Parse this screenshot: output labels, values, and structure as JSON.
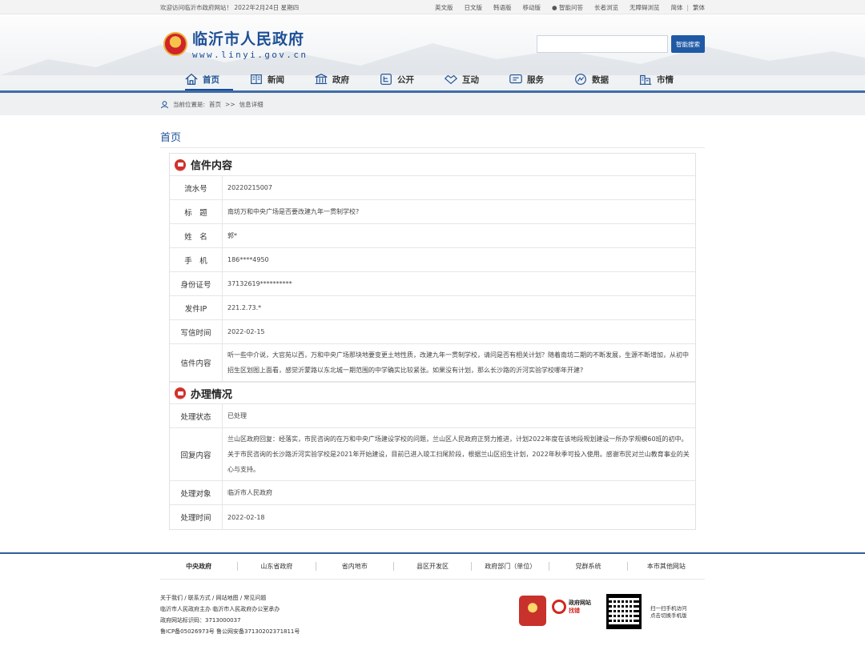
{
  "topbar": {
    "welcome": "欢迎访问临沂市政府网站！ 2022年2月24日 星期四",
    "links": [
      "英文版",
      "日文版",
      "韩语版",
      "移动版",
      "智能问答",
      "长者浏览",
      "无障碍浏览",
      "简体",
      "繁体"
    ]
  },
  "header": {
    "site_name": "临沂市人民政府",
    "site_url": "www.linyi.gov.cn",
    "search_button": "智能搜索",
    "search_placeholder": ""
  },
  "nav": [
    {
      "label": "首页",
      "icon": "home-icon"
    },
    {
      "label": "新闻",
      "icon": "newspaper-icon"
    },
    {
      "label": "政府",
      "icon": "building-icon"
    },
    {
      "label": "公开",
      "icon": "open-icon"
    },
    {
      "label": "互动",
      "icon": "handshake-icon"
    },
    {
      "label": "服务",
      "icon": "service-icon"
    },
    {
      "label": "数据",
      "icon": "data-icon"
    },
    {
      "label": "市情",
      "icon": "city-icon"
    }
  ],
  "breadcrumb": {
    "prefix": "当前位置是:",
    "home": "首页",
    "sep": ">>",
    "current": "信息详细"
  },
  "page_title": "首页",
  "letter": {
    "section_title": "信件内容",
    "rows": [
      {
        "label": "流水号",
        "value": "20220215007"
      },
      {
        "label": "标　题",
        "value": "南坊万和中央广场是否要改建九年一贯制学校?"
      },
      {
        "label": "姓　名",
        "value": "郭*"
      },
      {
        "label": "手　机",
        "value": "186****4950"
      },
      {
        "label": "身份证号",
        "value": "37132619**********"
      },
      {
        "label": "发件IP",
        "value": "221.2.73.*"
      },
      {
        "label": "写信时间",
        "value": "2022-02-15"
      },
      {
        "label": "信件内容",
        "value": "听一些中介说，大官苑以西，万和中央广场那块地要变更土地性质，改建九年一贯制学校，请问是否有相关计划？随着南坊二期的不断发展，生源不断增加，从初中招生区划图上面看，感觉沂蒙路以东北城一期范围的中学确实比较紧张。如果没有计划，那么长沙路的沂河实验学校哪年开建?"
      }
    ]
  },
  "handling": {
    "section_title": "办理情况",
    "rows": [
      {
        "label": "处理状态",
        "value": "已处理"
      },
      {
        "label": "回复内容",
        "value": "兰山区政府回复：经落实，市民咨询的在万和中央广场建设学校的问题，兰山区人民政府正努力推进，计划2022年度在该地段规划建设一所办学规模60班的初中。关于市民咨询的长沙路沂河实验学校是2021年开始建设，目前已进入竣工扫尾阶段，根据兰山区招生计划，2022年秋季可投入使用。感谢市民对兰山教育事业的关心与支持。"
      },
      {
        "label": "处理对象",
        "value": "临沂市人民政府"
      },
      {
        "label": "处理时间",
        "value": "2022-02-18"
      }
    ]
  },
  "footer": {
    "links": [
      "中央政府",
      "山东省政府",
      "省内地市",
      "县区开发区",
      "政府部门（单位）",
      "党群系统",
      "本市其他网站"
    ],
    "info": [
      "关于我们 / 联系方式 / 网站地图 / 常见问题",
      "临沂市人民政府主办 临沂市人民政府办公室承办",
      "政府网站标识码：3713000037",
      "鲁ICP备05026973号 鲁公网安备37130202371811号"
    ],
    "badge_text_1": "政府网站",
    "badge_text_2": "找错",
    "qr_text_1": "扫一扫手机访问",
    "qr_text_2": "点击切换手机版"
  }
}
